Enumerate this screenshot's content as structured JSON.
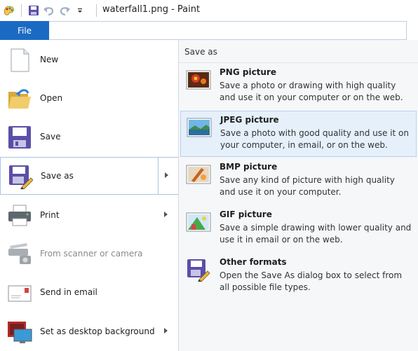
{
  "window": {
    "title": "waterfall1.png - Paint"
  },
  "quick_access": {
    "icons": [
      "paint-app-icon",
      "save-icon",
      "undo-icon",
      "redo-icon",
      "customize-dropdown-icon"
    ]
  },
  "ribbon": {
    "file_tab": "File"
  },
  "menu": {
    "items": [
      {
        "label": "New",
        "icon": "new-document-icon"
      },
      {
        "label": "Open",
        "icon": "open-folder-icon"
      },
      {
        "label": "Save",
        "icon": "save-icon"
      },
      {
        "label": "Save as",
        "icon": "save-as-icon"
      },
      {
        "label": "Print",
        "icon": "printer-icon"
      },
      {
        "label": "From scanner or camera",
        "icon": "scanner-icon"
      },
      {
        "label": "Send in email",
        "icon": "email-icon"
      },
      {
        "label": "Set as desktop background",
        "icon": "desktop-background-icon"
      }
    ]
  },
  "save_as": {
    "heading": "Save as",
    "options": [
      {
        "title": "PNG picture",
        "description": "Save a photo or drawing with high quality and use it on your computer or on the web.",
        "icon": "png-picture-icon"
      },
      {
        "title": "JPEG picture",
        "description": "Save a photo with good quality and use it on your computer, in email, or on the web.",
        "icon": "jpeg-picture-icon"
      },
      {
        "title": "BMP picture",
        "description": "Save any kind of picture with high quality and use it on your computer.",
        "icon": "bmp-picture-icon"
      },
      {
        "title": "GIF picture",
        "description": "Save a simple drawing with lower quality and use it in email or on the web.",
        "icon": "gif-picture-icon"
      },
      {
        "title": "Other formats",
        "description": "Open the Save As dialog box to select from all possible file types.",
        "icon": "other-formats-icon"
      }
    ]
  },
  "colors": {
    "file_tab": "#1a6ac4",
    "hover_bg": "#e5f0fb",
    "hover_border": "#b8d3ef"
  }
}
